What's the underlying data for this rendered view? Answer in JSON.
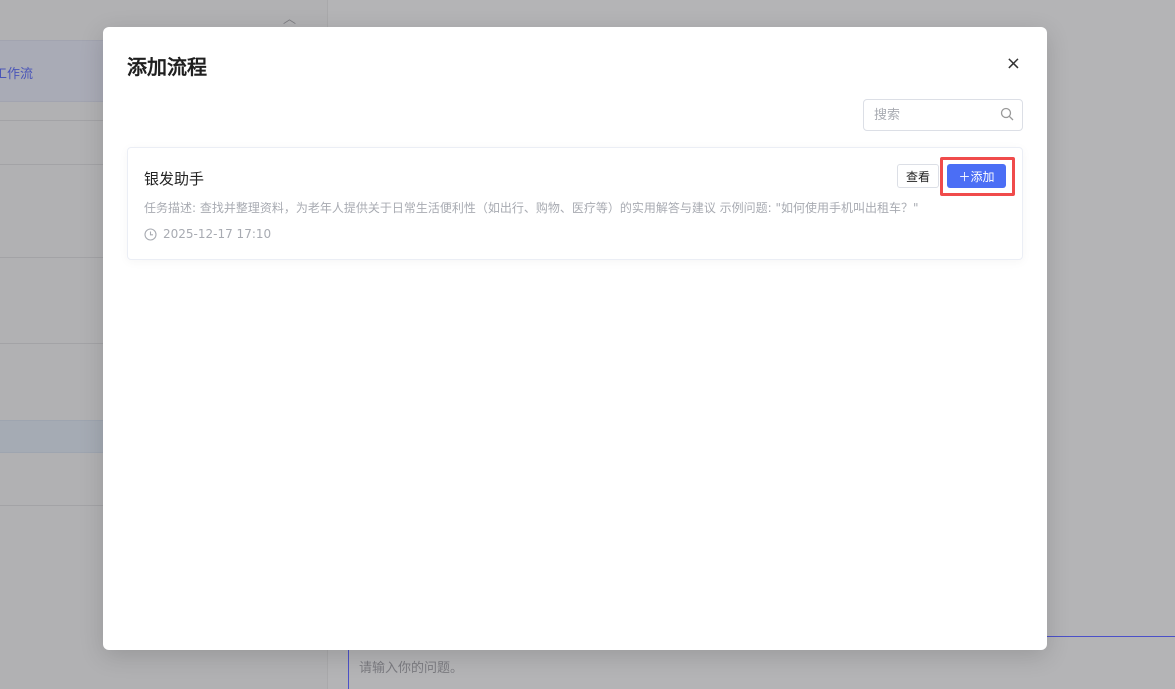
{
  "sidebar": {
    "active_item": "工作流"
  },
  "main": {
    "input_placeholder": "请输入你的问题。"
  },
  "modal": {
    "title": "添加流程",
    "close_icon": "×",
    "search_placeholder": "搜索",
    "items": [
      {
        "name": "银发助手",
        "description": "任务描述: 查找并整理资料，为老年人提供关于日常生活便利性（如出行、购物、医疗等）的实用解答与建议 示例问题: \"如何使用手机叫出租车？\"",
        "time": "2025-12-17 17:10",
        "view_label": "查看",
        "add_label": "添加"
      }
    ]
  },
  "colors": {
    "primary": "#4b6ef5",
    "highlight": "#f04b4b"
  }
}
